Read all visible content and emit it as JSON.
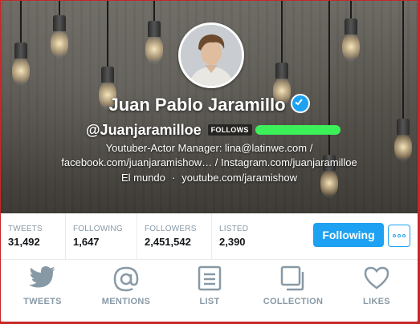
{
  "profile": {
    "name": "Juan Pablo Jaramillo",
    "handle": "@Juanjaramilloe",
    "follows_badge": "FOLLOWS",
    "bio_line1": "Youtuber-Actor Manager: lina@latinwe.com /",
    "bio_line2": "facebook.com/juanjaramishow… / Instagram.com/juanjaramilloe",
    "location": "El mundo",
    "separator": "·",
    "website": "youtube.com/jaramishow"
  },
  "stats": [
    {
      "label": "TWEETS",
      "value": "31,492"
    },
    {
      "label": "FOLLOWING",
      "value": "1,647"
    },
    {
      "label": "FOLLOWERS",
      "value": "2,451,542"
    },
    {
      "label": "LISTED",
      "value": "2,390"
    }
  ],
  "actions": {
    "following_label": "Following"
  },
  "nav": [
    {
      "label": "TWEETS",
      "icon": "bird-icon"
    },
    {
      "label": "MENTIONS",
      "icon": "at-sign-icon"
    },
    {
      "label": "LIST",
      "icon": "list-icon"
    },
    {
      "label": "COLLECTION",
      "icon": "collection-icon"
    },
    {
      "label": "LIKES",
      "icon": "heart-icon"
    }
  ],
  "colors": {
    "accent": "#1da1f2",
    "muted": "#8899a6",
    "redaction": "#3cf05a",
    "frame": "#c62828"
  }
}
